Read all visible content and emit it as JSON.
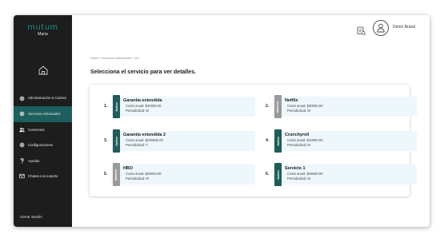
{
  "sidebar": {
    "logo": "mutum",
    "user_name": "Maria",
    "items": [
      {
        "label": "Administración & Cartera",
        "icon": "gear-icon"
      },
      {
        "label": "Servicios Adicionales",
        "icon": "gear-icon"
      },
      {
        "label": "Comercios",
        "icon": "users-icon"
      },
      {
        "label": "Configuraciones",
        "icon": "gear-icon"
      },
      {
        "label": "Ayudas",
        "icon": "question-icon"
      },
      {
        "label": "Chatea con soporte",
        "icon": "chat-icon"
      }
    ],
    "logout": "Cerrar Sesión"
  },
  "header": {
    "brand": "Demo Brand"
  },
  "breadcrumb": "Home / Servicios Adicionales / Ver",
  "page_title": "Selecciona el servicio para ver detalles.",
  "services": [
    {
      "num": "1.",
      "status": "Activo",
      "name": "Garantía extendida",
      "cost": "Costo anual: $30000.00",
      "period": "Periodicidad: M"
    },
    {
      "num": "2.",
      "status": "Inactivo",
      "name": "Netflix",
      "cost": "Costo anual: $30000.00",
      "period": "Periodicidad: M"
    },
    {
      "num": "3.",
      "status": "Activo",
      "name": "Garantía extendida 2",
      "cost": "Costo anual: $200000.00",
      "period": "Periodicidad: T"
    },
    {
      "num": "4.",
      "status": "Activo",
      "name": "Crunchyroll",
      "cost": "Costo anual: $10000.00",
      "period": "Periodicidad: M"
    },
    {
      "num": "5.",
      "status": "Inactivo",
      "name": "HBO",
      "cost": "Costo anual: $20000.00",
      "period": "Periodicidad: M"
    },
    {
      "num": "6.",
      "status": "Activo",
      "name": "Servicio 1",
      "cost": "Costo anual: $25000.00",
      "period": "Periodicidad: M"
    }
  ],
  "colors": {
    "sidebar_bg": "#1c1d1c",
    "accent": "#1f5d59",
    "nav_active": "#1d5f5c",
    "inactive_badge": "#9a9a9a",
    "card_bg": "#eef7fb",
    "logo": "#1e8a84"
  }
}
